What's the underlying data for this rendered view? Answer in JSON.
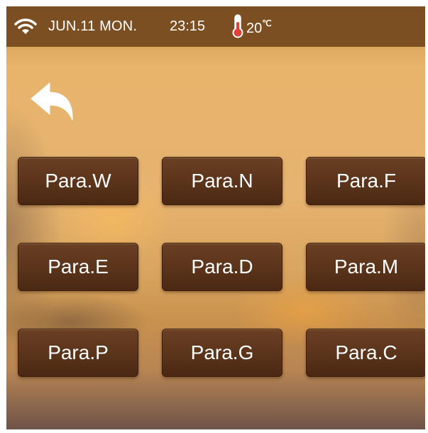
{
  "status_bar": {
    "date": "JUN.11 MON.",
    "time": "23:15",
    "temperature": "20",
    "temperature_unit": "℃"
  },
  "colors": {
    "status_bar_bg": "#7c4f22",
    "button_bg": "#5a331a",
    "button_text": "#ffffff",
    "thermometer": "#e0413a"
  },
  "icons": {
    "status_wifi": "wifi-icon",
    "status_temperature": "thermometer-icon",
    "back": "back-arrow-icon"
  },
  "buttons": [
    {
      "label": "Para.W"
    },
    {
      "label": "Para.N"
    },
    {
      "label": "Para.F"
    },
    {
      "label": "Para.E"
    },
    {
      "label": "Para.D"
    },
    {
      "label": "Para.M"
    },
    {
      "label": "Para.P"
    },
    {
      "label": "Para.G"
    },
    {
      "label": "Para.C"
    }
  ]
}
